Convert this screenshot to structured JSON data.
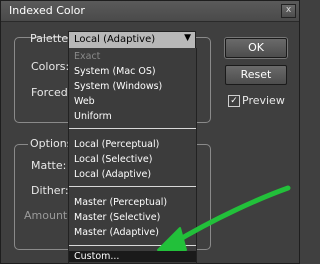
{
  "window": {
    "title": "Indexed Color",
    "close_glyph": "x"
  },
  "palette": {
    "label": "Palette:",
    "selected": "Local (Adaptive)",
    "arrow_glyph": "▼"
  },
  "fields": {
    "colors_label": "Colors:",
    "forced_label": "Forced:"
  },
  "options": {
    "legend": "Options",
    "matte_label": "Matte:",
    "dither_label": "Dither:",
    "amount_label": "Amount:"
  },
  "menu": {
    "items": [
      {
        "label": "Exact",
        "enabled": false
      },
      {
        "label": "System (Mac OS)",
        "enabled": true
      },
      {
        "label": "System (Windows)",
        "enabled": true
      },
      {
        "label": "Web",
        "enabled": true
      },
      {
        "label": "Uniform",
        "enabled": true
      },
      {
        "label": "Local (Perceptual)",
        "enabled": true
      },
      {
        "label": "Local (Selective)",
        "enabled": true
      },
      {
        "label": "Local (Adaptive)",
        "enabled": true
      },
      {
        "label": "Master (Perceptual)",
        "enabled": true
      },
      {
        "label": "Master (Selective)",
        "enabled": true
      },
      {
        "label": "Master (Adaptive)",
        "enabled": true
      },
      {
        "label": "Custom...",
        "enabled": true,
        "highlighted": true
      }
    ]
  },
  "buttons": {
    "ok": "OK",
    "reset": "Reset"
  },
  "preview": {
    "label": "Preview",
    "checked": true,
    "check_glyph": "✓"
  },
  "colors": {
    "annotation_arrow": "#22c03a",
    "dialog_bg": "#3f3f3f"
  },
  "annotation": {
    "icon": "arrow-pointing-to-custom"
  }
}
